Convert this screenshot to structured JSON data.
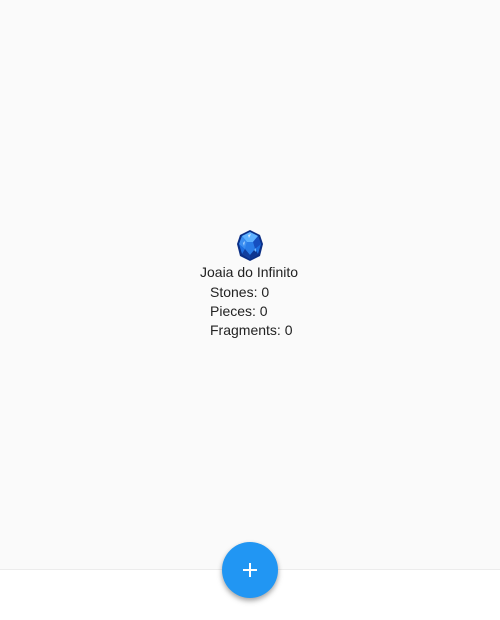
{
  "item": {
    "icon": "blue-gem-icon",
    "title": "Joaia do Infinito",
    "stones_label": "Stones: 0",
    "pieces_label": "Pieces: 0",
    "fragments_label": "Fragments: 0"
  },
  "fab": {
    "icon": "plus-icon"
  },
  "colors": {
    "background": "#fafafa",
    "fab": "#2196f3",
    "gem_primary": "#1e6fe0",
    "gem_light": "#5fb2ff",
    "gem_dark": "#0b2f86"
  }
}
